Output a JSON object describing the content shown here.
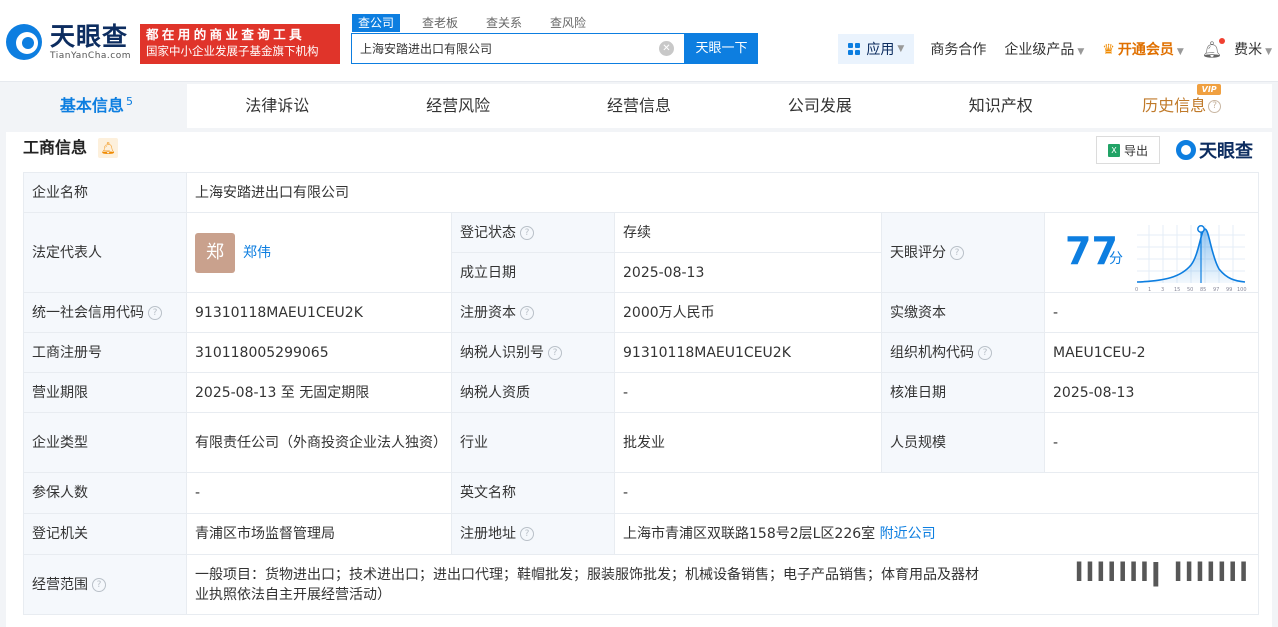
{
  "header": {
    "logo_cn": "天眼查",
    "logo_en": "TianYanCha.com",
    "slogan_line1": "都在用的商业查询工具",
    "slogan_line2": "国家中小企业发展子基金旗下机构",
    "search_tabs": [
      "查公司",
      "查老板",
      "查关系",
      "查风险"
    ],
    "search_value": "上海安踏进出口有限公司",
    "search_button": "天眼一下",
    "app_label": "应用",
    "business": "商务合作",
    "enterprise": "企业级产品",
    "vip_label": "开通会员",
    "user": "费米"
  },
  "tabs": [
    {
      "label": "基本信息",
      "count": "5"
    },
    {
      "label": "法律诉讼"
    },
    {
      "label": "经营风险"
    },
    {
      "label": "经营信息"
    },
    {
      "label": "公司发展"
    },
    {
      "label": "知识产权"
    },
    {
      "label": "历史信息",
      "badge": "VIP"
    }
  ],
  "panel": {
    "title": "工商信息",
    "export_label": "导出",
    "brand": "天眼查"
  },
  "info": {
    "company_name_label": "企业名称",
    "company_name": "上海安踏进出口有限公司",
    "legal_rep_label": "法定代表人",
    "legal_rep_avatar": "郑",
    "legal_rep": "郑伟",
    "reg_status_label": "登记状态",
    "reg_status": "存续",
    "founded_label": "成立日期",
    "founded": "2025-08-13",
    "score_label": "天眼评分",
    "score": "77",
    "score_unit": "分",
    "score_ticks": [
      "0",
      "1",
      "3",
      "15",
      "50",
      "85",
      "97",
      "99",
      "100"
    ],
    "credit_code_label": "统一社会信用代码",
    "credit_code": "91310118MAEU1CEU2K",
    "reg_capital_label": "注册资本",
    "reg_capital": "2000万人民币",
    "paid_capital_label": "实缴资本",
    "paid_capital": "-",
    "reg_no_label": "工商注册号",
    "reg_no": "310118005299065",
    "taxpayer_id_label": "纳税人识别号",
    "taxpayer_id": "91310118MAEU1CEU2K",
    "org_code_label": "组织机构代码",
    "org_code": "MAEU1CEU-2",
    "term_label": "营业期限",
    "term": "2025-08-13 至 无固定期限",
    "taxpayer_qual_label": "纳税人资质",
    "taxpayer_qual": "-",
    "approved_label": "核准日期",
    "approved": "2025-08-13",
    "type_label": "企业类型",
    "type": "有限责任公司（外商投资企业法人独资）",
    "industry_label": "行业",
    "industry": "批发业",
    "staff_label": "人员规模",
    "staff": "-",
    "insured_label": "参保人数",
    "insured": "-",
    "en_name_label": "英文名称",
    "en_name": "-",
    "authority_label": "登记机关",
    "authority": "青浦区市场监督管理局",
    "address_label": "注册地址",
    "address": "上海市青浦区双联路158号2层L区226室",
    "nearby": "附近公司",
    "scope_label": "经营范围",
    "scope": "一般项目：货物进出口；技术进出口；进出口代理；鞋帽批发；服装服饰批发；机械设备销售；电子产品销售；体育用品及器材",
    "scope_line2": "业执照依法自主开展经营活动）"
  }
}
